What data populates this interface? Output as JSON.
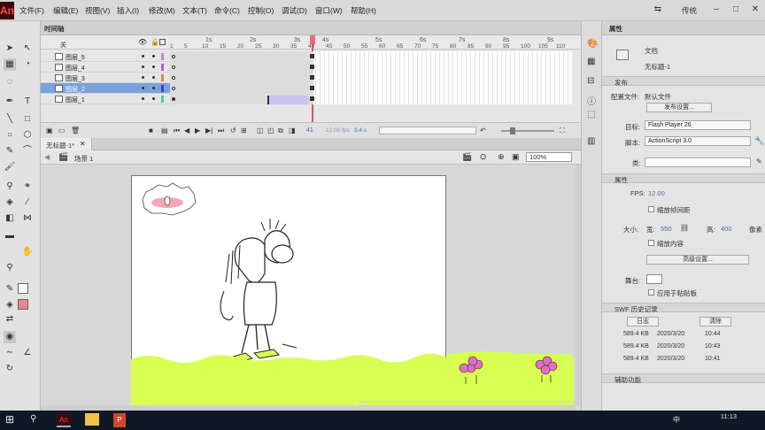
{
  "app": {
    "logo": "An"
  },
  "menu": [
    "文件(F)",
    "编辑(E)",
    "视图(V)",
    "插入(I)",
    "修改(M)",
    "文本(T)",
    "命令(C)",
    "控制(O)",
    "调试(D)",
    "窗口(W)",
    "帮助(H)"
  ],
  "workspace": "传统",
  "window_controls": {
    "minimize": "–",
    "maximize": "□",
    "close": "✕",
    "sync": "⇆"
  },
  "timeline": {
    "tab_label": "时间轴",
    "header_label": "关",
    "ruler_seconds": [
      "1s",
      "2s",
      "3s",
      "4s",
      "5s",
      "6s",
      "7s",
      "8s",
      "9s"
    ],
    "ruler_frames": [
      "1",
      "5",
      "10",
      "15",
      "20",
      "25",
      "30",
      "35",
      "40",
      "45",
      "50",
      "55",
      "60",
      "65",
      "70",
      "75",
      "80",
      "85",
      "90",
      "95",
      "100",
      "105",
      "110"
    ],
    "layers": [
      {
        "name": "图层_5",
        "color": "#c77fd6",
        "selected": false
      },
      {
        "name": "图层_4",
        "color": "#c74fd6",
        "selected": false
      },
      {
        "name": "图层_3",
        "color": "#d98a33",
        "selected": false
      },
      {
        "name": "图层_2",
        "color": "#3f3fc9",
        "selected": true
      },
      {
        "name": "图层_1",
        "color": "#48c9b6",
        "selected": false
      }
    ],
    "current_frame": "41",
    "fps": "12.00 fps",
    "elapsed": "3.4 s"
  },
  "document": {
    "tab_label": "无标题-1*",
    "scene": "场景 1",
    "zoom": "100%"
  },
  "properties": {
    "tab_label": "属性",
    "doc_type": "文档",
    "doc_name": "无标题-1",
    "publish_section": "发布",
    "profile_label": "配置文件:",
    "profile_value": "默认文件",
    "publish_settings_button": "发布设置...",
    "target_label": "目标:",
    "target_value": "Flash Player 26",
    "script_label": "脚本:",
    "script_value": "ActionScript 3.0",
    "class_label": "类:",
    "attributes_section": "属性",
    "fps_label": "FPS:",
    "fps_value": "12.00",
    "scale_span_label": "缩放帧间距",
    "size_label": "大小:",
    "width_value": "550",
    "width_label": "宽:",
    "height_label": "高:",
    "height_value": "400",
    "unit_label": "像素",
    "scale_content_label": "缩放内容",
    "advanced_button": "高级设置...",
    "stage_label": "舞台:",
    "apply_pasteboard_label": "应用于粘贴板",
    "swf_section": "SWF 历史记录",
    "log_button": "日志",
    "clear_button": "清除",
    "history": [
      {
        "size": "589.4 KB",
        "date": "2020/3/20",
        "time": "10:44"
      },
      {
        "size": "589.4 KB",
        "date": "2020/3/20",
        "time": "10:43"
      },
      {
        "size": "589.4 KB",
        "date": "2020/3/20",
        "time": "10:41"
      }
    ],
    "accessibility_section": "辅助功能"
  },
  "taskbar": {
    "time": "11:13",
    "ime": "中"
  },
  "colors": {
    "playhead": "#e0505b",
    "grass": "#d8ff52",
    "accent_blue": "#3e6fb0"
  }
}
